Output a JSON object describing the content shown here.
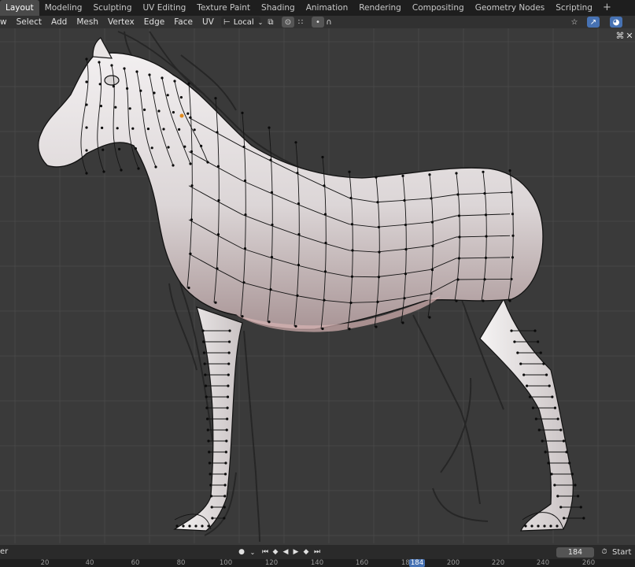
{
  "workspace_tabs": [
    "Layout",
    "Modeling",
    "Sculpting",
    "UV Editing",
    "Texture Paint",
    "Shading",
    "Animation",
    "Rendering",
    "Compositing",
    "Geometry Nodes",
    "Scripting"
  ],
  "workspace_add": "+",
  "header_menus": [
    "w",
    "Select",
    "Add",
    "Mesh",
    "Vertex",
    "Edge",
    "Face",
    "UV"
  ],
  "transform_orientation": "Local",
  "timeline": {
    "left_label": "er",
    "current_frame": "184",
    "start_label": "Start",
    "ruler_ticks": [
      "20",
      "40",
      "60",
      "80",
      "100",
      "120",
      "140",
      "160",
      "180",
      "200",
      "220",
      "240",
      "260"
    ],
    "ruler_current": "184"
  },
  "colors": {
    "accent": "#4772b3",
    "topbar_bg": "#1e1e1e",
    "viewport_bg": "#3a3a3a",
    "grid_line": "#474747",
    "mesh_wire": "#111111",
    "mesh_surface": "#e9e5e5",
    "active_tab": "#4a4a4a"
  },
  "icons": [
    "pivot-icon",
    "snap-magnet-icon",
    "snap-grid-icon",
    "proportional-edit-icon",
    "falloff-icon",
    "gizmo-icon",
    "overlay-icon",
    "shading-icon",
    "close-icon",
    "maximize-icon",
    "stopwatch-icon",
    "jump-start-icon",
    "prev-keyframe-icon",
    "play-reverse-icon",
    "play-icon",
    "next-keyframe-icon",
    "jump-end-icon",
    "keyframe-dot-icon"
  ]
}
